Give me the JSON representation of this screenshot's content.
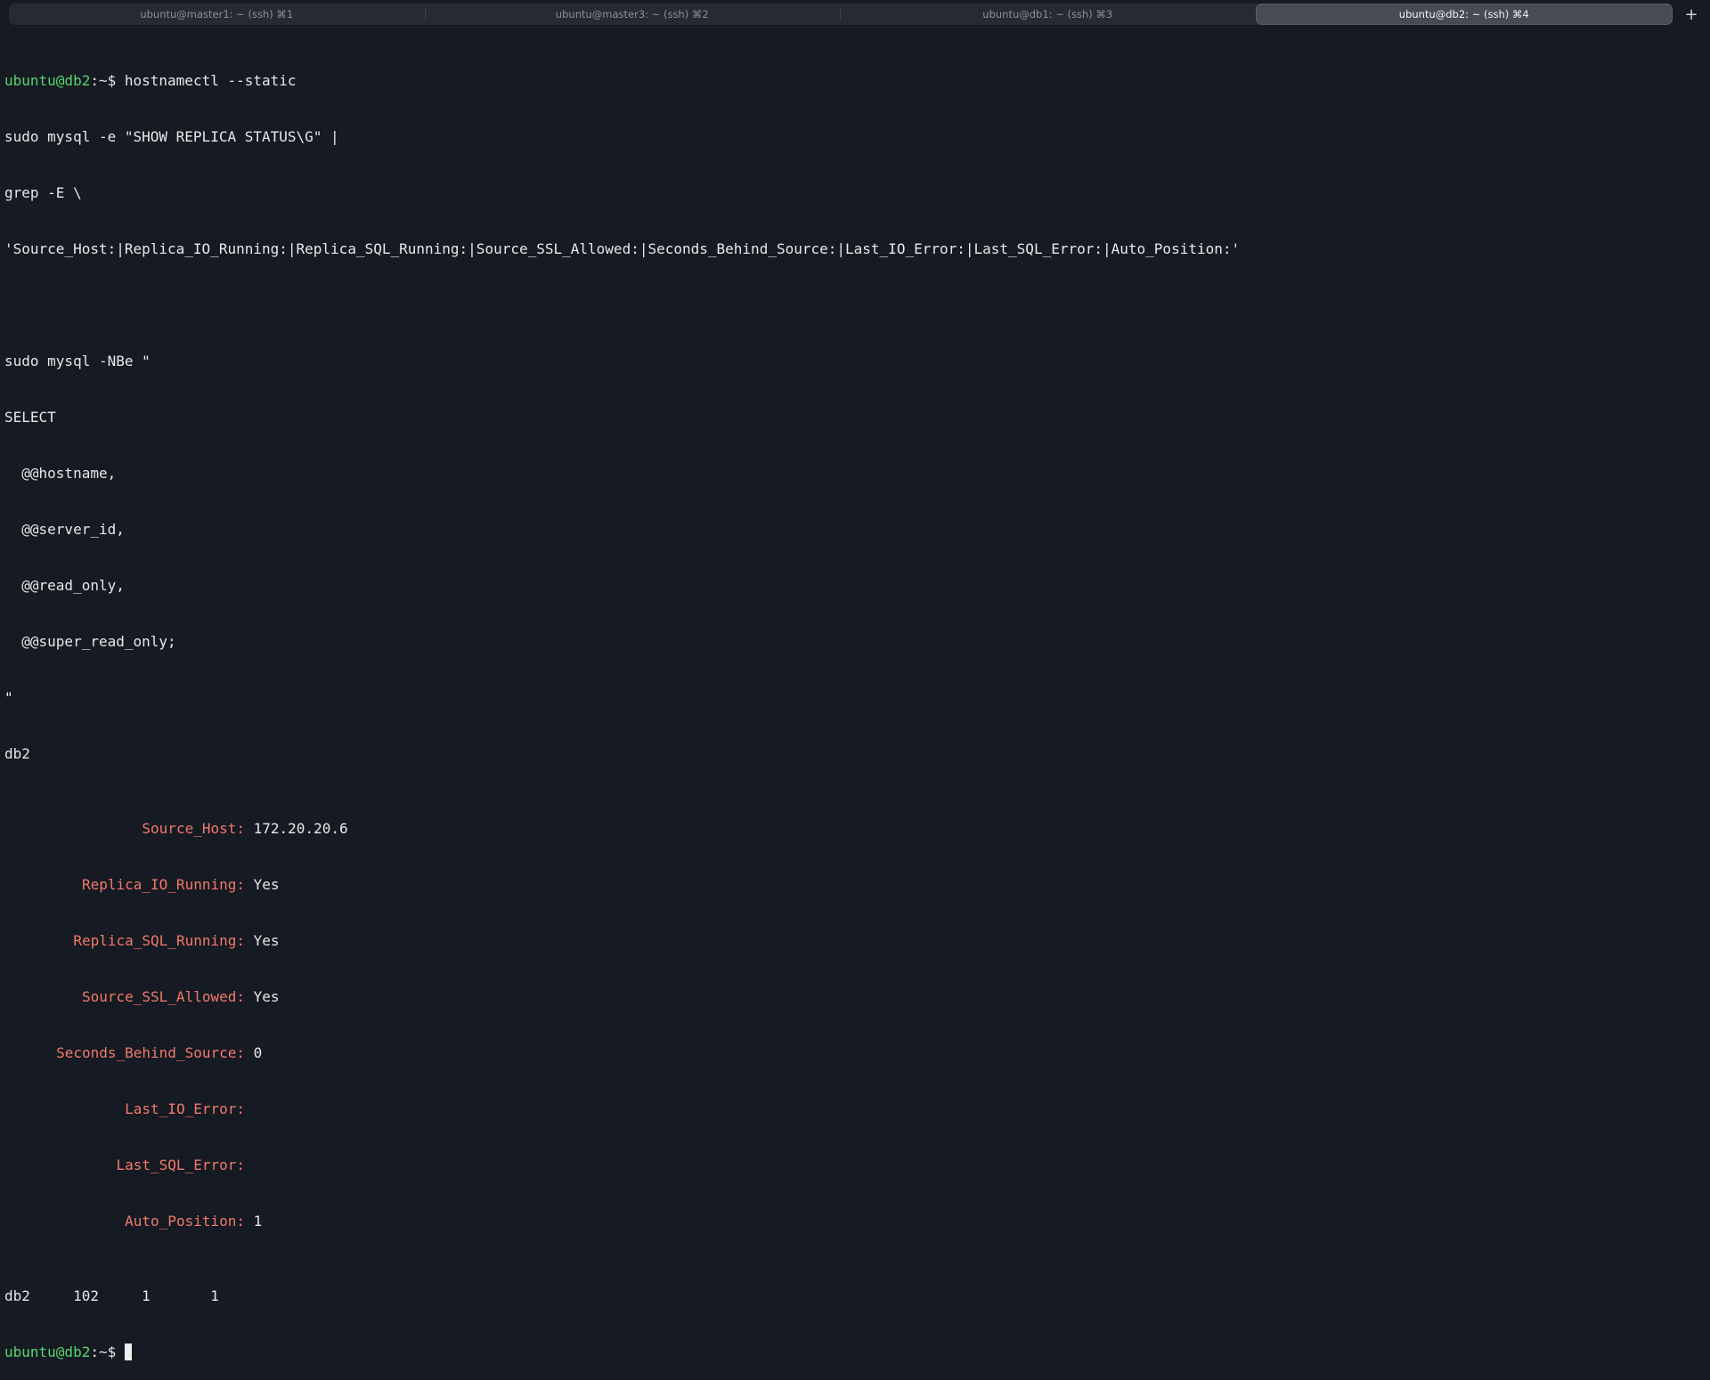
{
  "tabs": [
    {
      "label": "ubuntu@master1: ~ (ssh) ⌘1",
      "active": false
    },
    {
      "label": "ubuntu@master3: ~ (ssh) ⌘2",
      "active": false
    },
    {
      "label": "ubuntu@db1: ~ (ssh) ⌘3",
      "active": false
    },
    {
      "label": "ubuntu@db2: ~ (ssh) ⌘4",
      "active": true
    }
  ],
  "new_tab_label": "+",
  "prompt": {
    "user_host": "ubuntu@db2",
    "path": ":~$"
  },
  "command": "hostnamectl --static",
  "command_lines": [
    "sudo mysql -e \"SHOW REPLICA STATUS\\G\" |",
    "grep -E \\",
    "'Source_Host:|Replica_IO_Running:|Replica_SQL_Running:|Source_SSL_Allowed:|Seconds_Behind_Source:|Last_IO_Error:|Last_SQL_Error:|Auto_Position:'",
    "",
    "sudo mysql -NBe \"",
    "SELECT",
    "  @@hostname,",
    "  @@server_id,",
    "  @@read_only,",
    "  @@super_read_only;",
    "\""
  ],
  "hostname_output": "db2",
  "replica_status": [
    {
      "key": "Source_Host:",
      "value": "172.20.20.6"
    },
    {
      "key": "Replica_IO_Running:",
      "value": "Yes"
    },
    {
      "key": "Replica_SQL_Running:",
      "value": "Yes"
    },
    {
      "key": "Source_SSL_Allowed:",
      "value": "Yes"
    },
    {
      "key": "Seconds_Behind_Source:",
      "value": "0"
    },
    {
      "key": "Last_IO_Error:",
      "value": ""
    },
    {
      "key": "Last_SQL_Error:",
      "value": ""
    },
    {
      "key": "Auto_Position:",
      "value": "1"
    }
  ],
  "select_output": "db2     102     1       1"
}
